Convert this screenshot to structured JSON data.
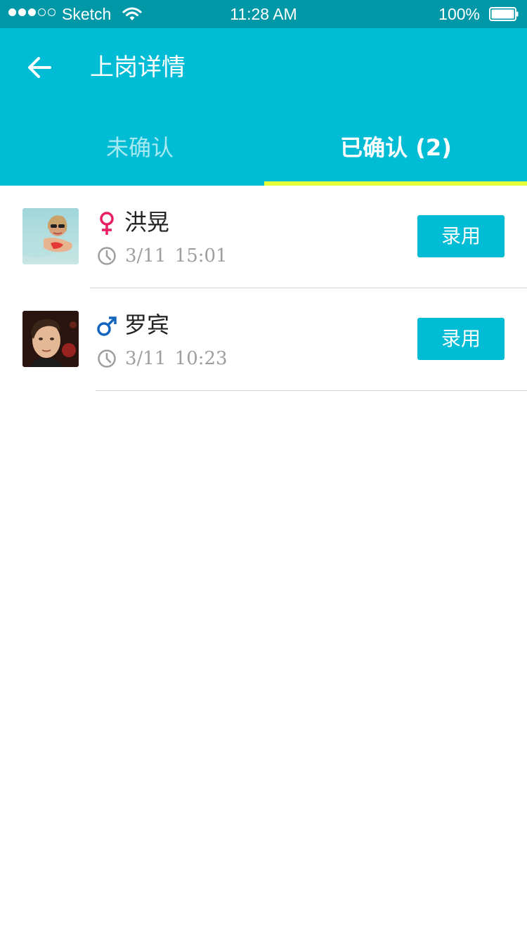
{
  "status_bar": {
    "carrier": "Sketch",
    "time": "11:28 AM",
    "battery": "100%",
    "battery_level": 1.0,
    "signal_bars_filled": 3,
    "signal_bars_total": 5
  },
  "header": {
    "title": "上岗详情",
    "back_icon": "arrow-left-icon"
  },
  "tabs": [
    {
      "label": "未确认",
      "active": false
    },
    {
      "label": "已确认 (2)",
      "active": true
    }
  ],
  "candidates": [
    {
      "name": "洪晃",
      "gender": "female",
      "gender_symbol": "♀",
      "time": "3/11  15:01",
      "action_label": "录用"
    },
    {
      "name": "罗宾",
      "gender": "male",
      "gender_symbol": "♂",
      "time": "3/11  10:23",
      "action_label": "录用"
    }
  ],
  "colors": {
    "status_bar": "#0097a7",
    "primary": "#00bcd4",
    "tab_indicator": "#e4ff38",
    "female": "#e91e63",
    "male": "#1565c0",
    "time_text": "#9e9e9e",
    "divider": "#d5d5d5"
  }
}
